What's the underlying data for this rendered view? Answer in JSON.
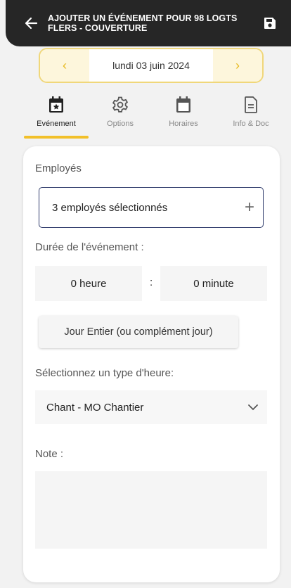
{
  "header": {
    "title_line1": "AJOUTER UN ÉVÉNEMENT POUR 98 LOGTS",
    "title_line2": "FLERS - COUVERTURE",
    "back_icon": "arrow-left-icon",
    "save_icon": "floppy-save-icon"
  },
  "date_nav": {
    "prev": "‹",
    "date": "lundi 03 juin 2024",
    "next": "›",
    "accent": "#f0d77a"
  },
  "tabs": [
    {
      "label": "Evénement",
      "icon": "calendar-star-icon",
      "active": true
    },
    {
      "label": "Options",
      "icon": "gear-icon",
      "active": false
    },
    {
      "label": "Horaires",
      "icon": "calendar-icon",
      "active": false
    },
    {
      "label": "Info & Doc",
      "icon": "document-icon",
      "active": false
    }
  ],
  "form": {
    "employees_label": "Employés",
    "employees_value": "3 employés sélectionnés",
    "add_symbol": "+",
    "duration_label": "Durée de l'événement :",
    "hours_value": "0 heure",
    "separator": ":",
    "minutes_value": "0 minute",
    "full_day_button": "Jour Entier (ou complément jour)",
    "hour_type_label": "Sélectionnez un type d'heure:",
    "hour_type_value": "Chant - MO Chantier",
    "note_label": "Note :",
    "note_value": ""
  },
  "colors": {
    "appbar": "#262626",
    "tab_indicator": "#f2c02a",
    "employees_border": "#2f3b6b"
  }
}
